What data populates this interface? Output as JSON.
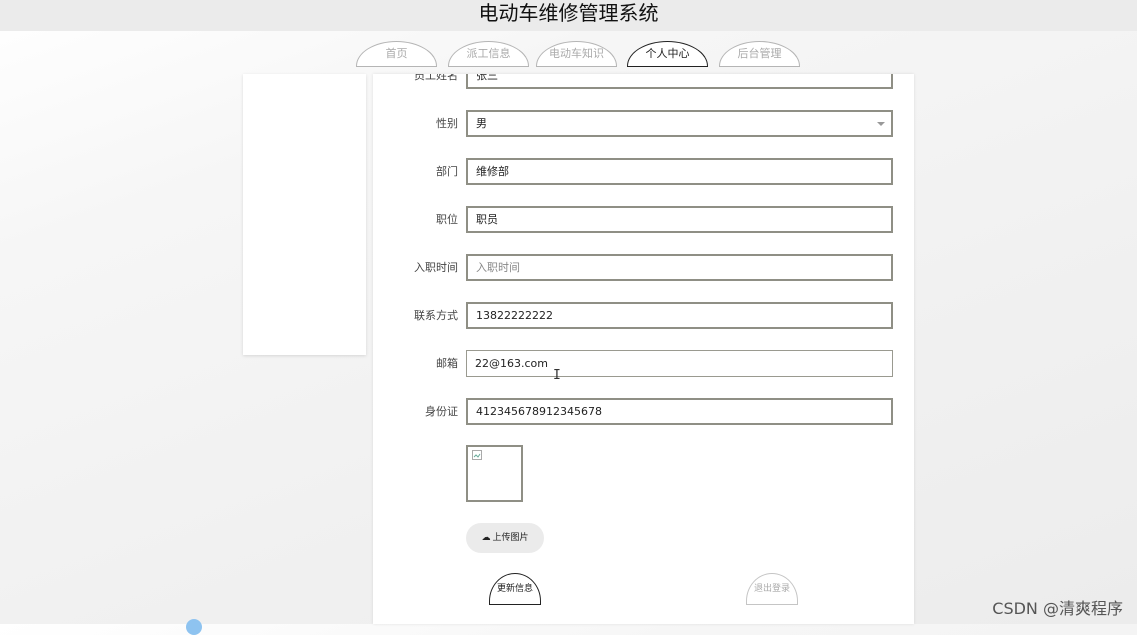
{
  "header": {
    "title": "电动车维修管理系统"
  },
  "nav": {
    "tabs": [
      {
        "label": "首页"
      },
      {
        "label": "派工信息"
      },
      {
        "label": "电动车知识"
      },
      {
        "label": "个人中心",
        "active": true
      },
      {
        "label": "后台管理"
      }
    ]
  },
  "form": {
    "employee_name": {
      "label": "员工姓名",
      "value": "张三"
    },
    "gender": {
      "label": "性别",
      "value": "男"
    },
    "department": {
      "label": "部门",
      "value": "维修部"
    },
    "position": {
      "label": "职位",
      "value": "职员"
    },
    "hire_date": {
      "label": "入职时间",
      "value": "",
      "placeholder": "入职时间"
    },
    "phone": {
      "label": "联系方式",
      "value": "13822222222"
    },
    "email": {
      "label": "邮箱",
      "value": "22@163.com"
    },
    "id_card": {
      "label": "身份证",
      "value": "412345678912345678"
    },
    "upload_label": "上传图片",
    "update_label": "更新信息",
    "logout_label": "退出登录"
  },
  "watermark": "CSDN @清爽程序"
}
